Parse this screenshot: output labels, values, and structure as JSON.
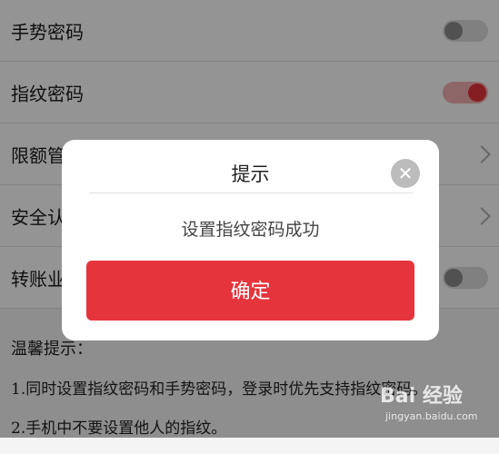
{
  "settings": {
    "rows": [
      {
        "label": "手势密码",
        "control": "toggle",
        "on": false
      },
      {
        "label": "指纹密码",
        "control": "toggle",
        "on": true
      },
      {
        "label": "限额管",
        "control": "chevron"
      },
      {
        "label": "安全认",
        "control": "chevron"
      },
      {
        "label": "转账业",
        "control": "toggle",
        "on": false
      }
    ]
  },
  "tips": {
    "title": "温馨提示：",
    "lines": [
      "1.同时设置指纹密码和手势密码，登录时优先支持指纹密码。",
      "2.手机中不要设置他人的指纹。"
    ]
  },
  "dialog": {
    "title": "提示",
    "close_icon": "close-icon",
    "message": "设置指纹密码成功",
    "confirm_label": "确定"
  },
  "watermark": {
    "logo_text": "Bai 经验",
    "url": "jingyan.baidu.com"
  },
  "colors": {
    "accent": "#e5343c",
    "toggle_on_track": "#f3b1b1",
    "toggle_off_track": "#dcdcdc"
  }
}
